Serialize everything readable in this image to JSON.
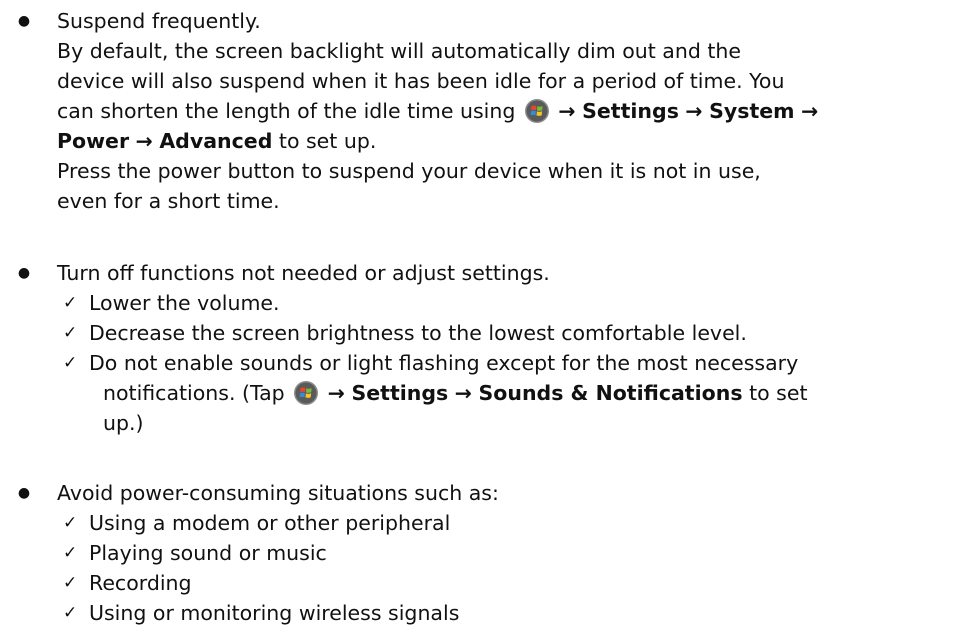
{
  "bullets": [
    {
      "title": "Suspend frequently.",
      "line1": "By default, the screen backlight will automatically dim out and the",
      "line2": "device will also suspend when it has been idle for a period of time. You",
      "line3_pre": "can shorten the length of the idle time using",
      "line3_arrow1": "→",
      "settings": "Settings",
      "arrow": "→",
      "system": "System",
      "power": "Power",
      "advanced": "Advanced",
      "line4_post": "to set up.",
      "line5": "Press the power button to suspend your device when it is not in use,",
      "line6": "even for a short time."
    },
    {
      "title": "Turn off functions not needed or adjust settings.",
      "checks": [
        "Lower the volume.",
        "Decrease the screen brightness to the lowest comfortable level."
      ],
      "check3_line1": "Do not enable sounds or light flashing except for the most necessary",
      "check3_line2_pre": "notifications. (Tap",
      "check3_arrow": "→",
      "check3_settings": "Settings",
      "check3_sounds": "Sounds & Notifications",
      "check3_line2_post": "to set",
      "check3_line3": "up.)"
    },
    {
      "title": "Avoid power-consuming situations such as:",
      "checks": [
        "Using a modem or other peripheral",
        "Playing sound or music",
        "Recording",
        "Using or monitoring wireless signals"
      ]
    }
  ],
  "bullet_symbol": "●",
  "check_symbol": "✓",
  "icons": {
    "start": "windows-start-icon"
  },
  "colors": {
    "text": "#111111",
    "logo_ring": "#7f7f7f",
    "logo_red": "#e8452c",
    "logo_green": "#7cbb3a",
    "logo_blue": "#2f8ee0",
    "logo_yellow": "#f7c523"
  }
}
